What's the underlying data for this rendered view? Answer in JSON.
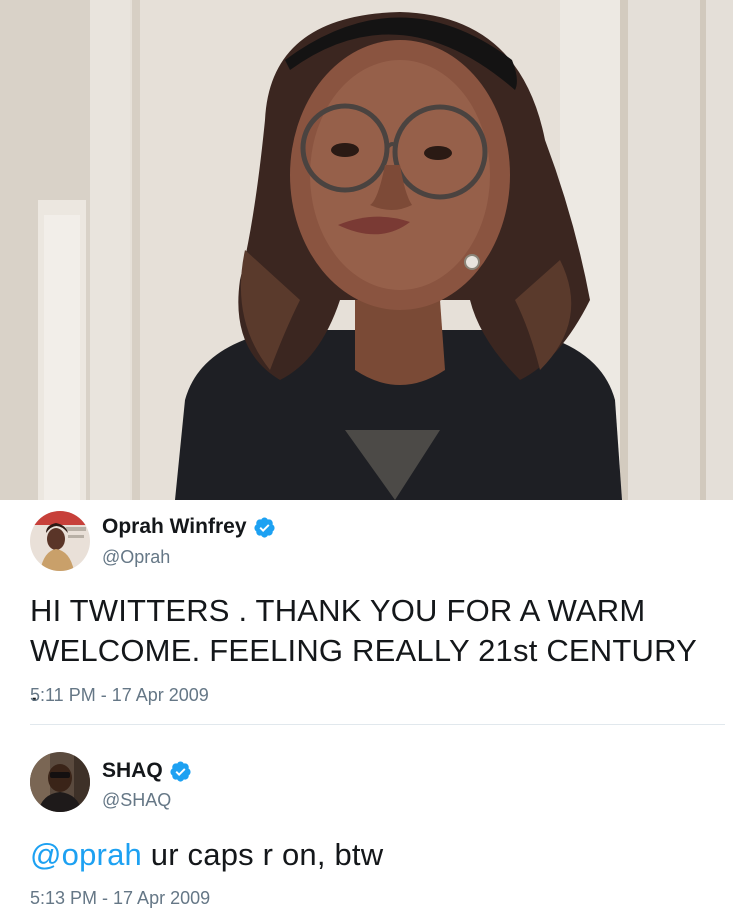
{
  "tweets": [
    {
      "name": "Oprah Winfrey",
      "handle": "@Oprah",
      "verified": true,
      "avatar_icon": "avatar-photo",
      "text": "HI TWITTERS . THANK YOU FOR A WARM WELCOME. FEELING REALLY 21st CENTURY .",
      "timestamp": "5:11 PM - 17 Apr 2009"
    },
    {
      "name": "SHAQ",
      "handle": "@SHAQ",
      "verified": true,
      "avatar_icon": "avatar-photo",
      "mention": "@oprah",
      "text_rest": " ur caps r on, btw",
      "timestamp": "5:13 PM - 17 Apr 2009"
    }
  ],
  "colors": {
    "accent": "#1da1f2",
    "secondary_text": "#657786",
    "primary_text": "#14171a",
    "divider": "#e1e8ed"
  },
  "icons": [
    "verified-badge-icon",
    "avatar-photo"
  ]
}
